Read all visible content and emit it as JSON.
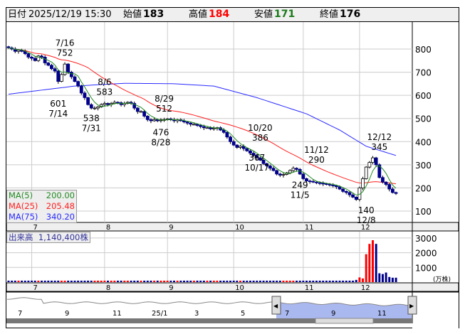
{
  "header": {
    "date_label": "日付",
    "datetime": "2025/12/19 15:30",
    "open_label": "始値",
    "open": "183",
    "high_label": "高値",
    "high": "184",
    "low_label": "安値",
    "low": "171",
    "close_label": "終値",
    "close": "176"
  },
  "legend": {
    "ma5_label": "MA(5)",
    "ma5": "200.00",
    "ma25_label": "MA(25)",
    "ma25": "205.48",
    "ma75_label": "MA(75)",
    "ma75": "340.20"
  },
  "volume_box": {
    "label": "出来高",
    "value": "1,140,400株"
  },
  "volume_unit": "(万株)",
  "colors": {
    "up": "#ffffff",
    "down": "#00008b",
    "ma5": "#228b22",
    "ma25": "#ff2020",
    "ma75": "#2a2aff",
    "vol_up": "#ff0000",
    "vol_down": "#00008b",
    "nav_fill": "#aab8f0"
  },
  "chart_data": {
    "type": "candlestick",
    "price_axis": {
      "ticks": [
        800,
        700,
        600,
        500,
        400,
        300,
        200,
        100
      ],
      "range": [
        40,
        900
      ]
    },
    "volume_axis": {
      "ticks": [
        3000,
        2000,
        1000
      ],
      "range": [
        0,
        3350
      ],
      "unit": "万株"
    },
    "month_ticks": [
      {
        "label": "7",
        "index": 7
      },
      {
        "label": "8",
        "index": 29
      },
      {
        "label": "9",
        "index": 48
      },
      {
        "label": "10",
        "index": 68
      },
      {
        "label": "11",
        "index": 89
      },
      {
        "label": "12",
        "index": 106
      }
    ],
    "closes": [
      805,
      800,
      790,
      795,
      790,
      780,
      765,
      760,
      750,
      770,
      765,
      740,
      730,
      715,
      705,
      660,
      690,
      735,
      700,
      680,
      660,
      640,
      610,
      590,
      560,
      545,
      545,
      550,
      560,
      565,
      560,
      565,
      570,
      568,
      560,
      565,
      570,
      565,
      545,
      530,
      530,
      510,
      495,
      490,
      495,
      490,
      495,
      495,
      498,
      495,
      490,
      495,
      490,
      485,
      480,
      475,
      475,
      470,
      465,
      460,
      460,
      455,
      458,
      460,
      450,
      440,
      420,
      400,
      385,
      375,
      380,
      370,
      360,
      350,
      340,
      330,
      320,
      305,
      295,
      285,
      275,
      260,
      255,
      258,
      265,
      275,
      285,
      280,
      260,
      240,
      230,
      228,
      225,
      222,
      220,
      218,
      215,
      212,
      210,
      205,
      195,
      185,
      180,
      170,
      160,
      150,
      200,
      240,
      290,
      310,
      330,
      300,
      245,
      225,
      215,
      195,
      180,
      176
    ],
    "ma75": [
      [
        0,
        605
      ],
      [
        20,
        640
      ],
      [
        35,
        652
      ],
      [
        50,
        650
      ],
      [
        62,
        640
      ],
      [
        75,
        590
      ],
      [
        90,
        520
      ],
      [
        100,
        450
      ],
      [
        108,
        380
      ],
      [
        117,
        340
      ]
    ],
    "volumes": [
      100,
      100,
      100,
      100,
      100,
      100,
      100,
      100,
      100,
      100,
      100,
      100,
      100,
      100,
      100,
      100,
      100,
      100,
      100,
      100,
      100,
      100,
      100,
      100,
      100,
      100,
      100,
      100,
      100,
      100,
      100,
      100,
      100,
      100,
      100,
      100,
      100,
      100,
      100,
      100,
      100,
      100,
      100,
      100,
      100,
      100,
      100,
      100,
      100,
      100,
      100,
      100,
      100,
      100,
      100,
      100,
      100,
      100,
      100,
      100,
      100,
      100,
      100,
      100,
      100,
      100,
      100,
      100,
      100,
      100,
      100,
      100,
      100,
      100,
      100,
      100,
      100,
      100,
      100,
      100,
      100,
      100,
      100,
      100,
      100,
      100,
      100,
      100,
      100,
      100,
      100,
      100,
      100,
      100,
      100,
      100,
      100,
      100,
      100,
      100,
      100,
      100,
      100,
      100,
      100,
      150,
      320,
      250,
      1900,
      2600,
      2850,
      2600,
      600,
      550,
      650,
      350,
      300,
      300
    ],
    "annotations": [
      {
        "date": "7/16",
        "value": "752",
        "index": 17,
        "price": 752,
        "pos": "above"
      },
      {
        "date": "7/14",
        "value": "601",
        "index": 15,
        "price": 601,
        "pos": "below"
      },
      {
        "date": "8/6",
        "value": "583",
        "index": 29,
        "price": 583,
        "pos": "above"
      },
      {
        "date": "7/31",
        "value": "538",
        "index": 25,
        "price": 538,
        "pos": "below"
      },
      {
        "date": "8/29",
        "value": "512",
        "index": 47,
        "price": 512,
        "pos": "above"
      },
      {
        "date": "8/28",
        "value": "476",
        "index": 46,
        "price": 476,
        "pos": "below"
      },
      {
        "date": "10/20",
        "value": "386",
        "index": 76,
        "price": 386,
        "pos": "above"
      },
      {
        "date": "10/17",
        "value": "367",
        "index": 75,
        "price": 367,
        "pos": "below"
      },
      {
        "date": "11/12",
        "value": "290",
        "index": 93,
        "price": 290,
        "pos": "above"
      },
      {
        "date": "11/5",
        "value": "249",
        "index": 88,
        "price": 249,
        "pos": "below"
      },
      {
        "date": "12/12",
        "value": "345",
        "index": 112,
        "price": 345,
        "pos": "above"
      },
      {
        "date": "12/8",
        "value": "140",
        "index": 108,
        "price": 140,
        "pos": "below"
      }
    ],
    "navigator_labels": [
      "7",
      "9",
      "11",
      "25/1",
      "3",
      "5",
      "7",
      "9",
      "11"
    ]
  }
}
